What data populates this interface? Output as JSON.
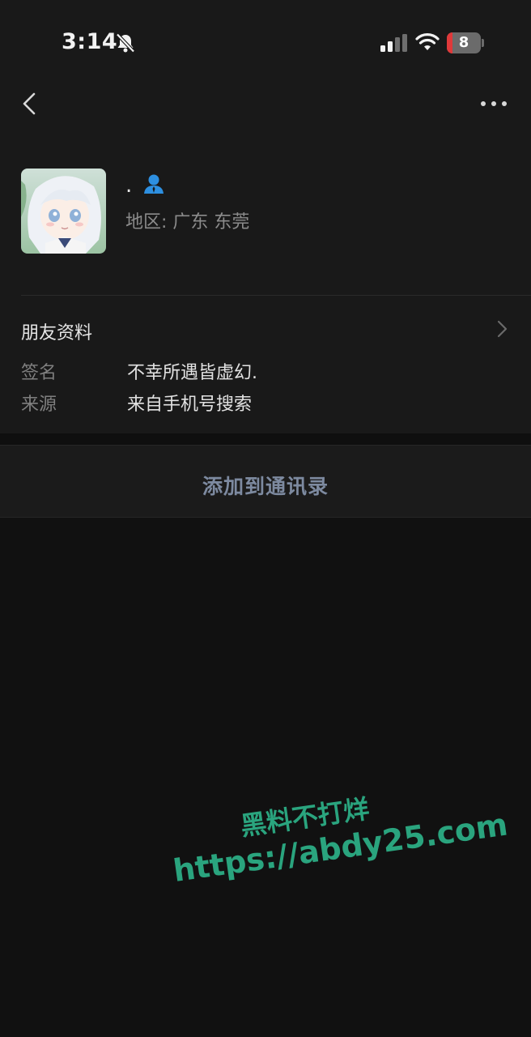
{
  "status_bar": {
    "time": "3:14",
    "battery_level": "8",
    "battery_fraction": 0.08,
    "icons": [
      "bell-off-icon",
      "cellular-signal-icon",
      "wifi-icon",
      "battery-icon"
    ]
  },
  "nav": {
    "back_icon": "chevron-left-icon",
    "more_icon": "more-horizontal-icon"
  },
  "profile": {
    "nickname": ".",
    "badge_icon": "contact-person-icon",
    "region": "地区: 广东 东莞"
  },
  "friend_info": {
    "title": "朋友资料",
    "chevron_icon": "chevron-right-icon",
    "fields": [
      {
        "label": "签名",
        "value": "不幸所遇皆虚幻."
      },
      {
        "label": "来源",
        "value": "来自手机号搜索"
      }
    ]
  },
  "actions": {
    "add_to_contacts": "添加到通讯录"
  },
  "watermark": {
    "line1": "黑料不打烊",
    "line2": "https://abdy25.com"
  },
  "colors": {
    "background": "#111111",
    "card": "#191919",
    "action_text": "#7d8aa0",
    "badge": "#2d8fe0",
    "watermark": "#2aa47e",
    "battery_low": "#e0393a"
  }
}
